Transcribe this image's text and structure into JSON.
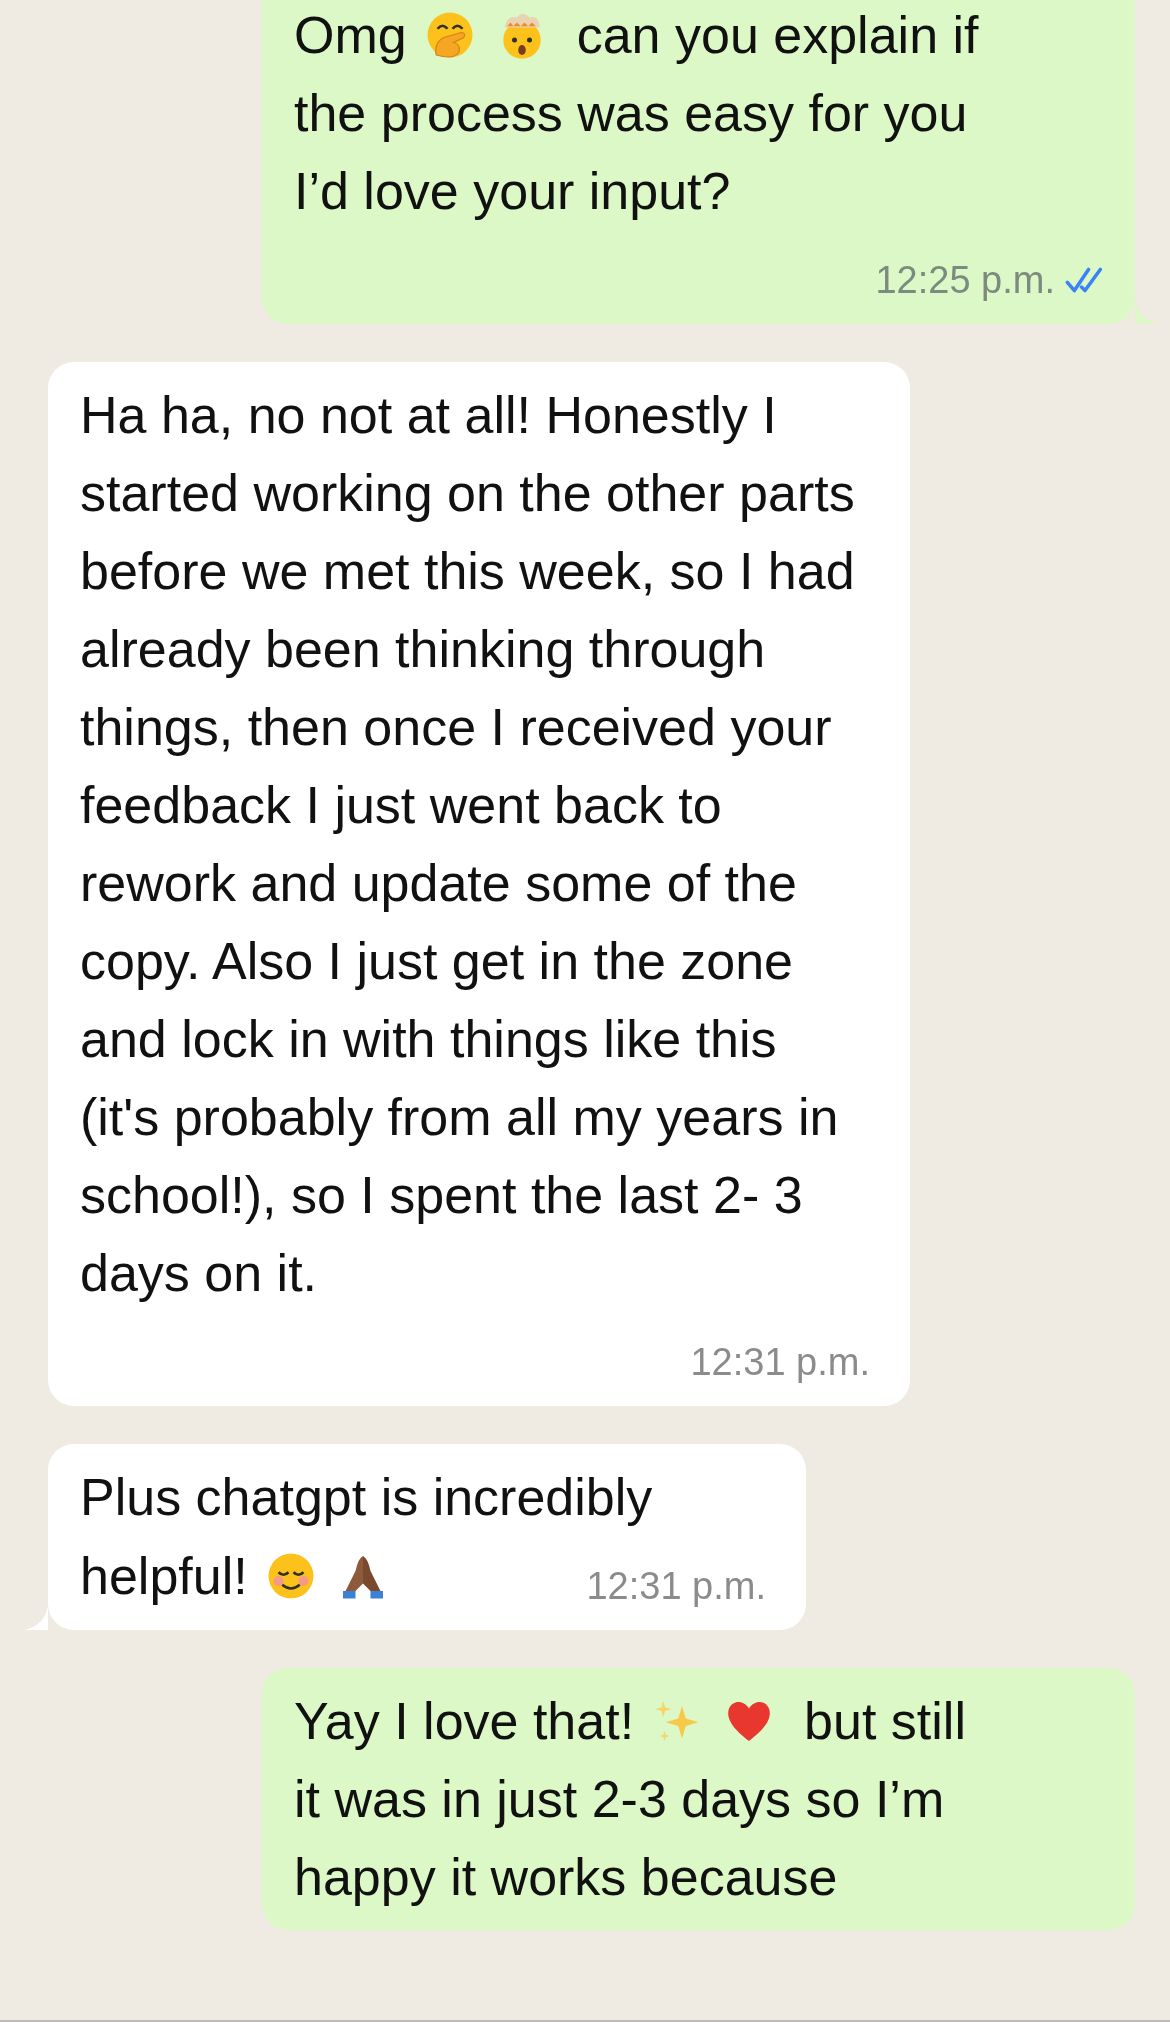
{
  "messages": [
    {
      "outgoing": true,
      "tail": true,
      "lines": [
        [
          {
            "kind": "text",
            "text": "Omg"
          },
          {
            "kind": "hand-over-mouth"
          },
          {
            "kind": "exploding-head"
          },
          {
            "kind": "text",
            "text": "can you explain if"
          }
        ],
        [
          {
            "kind": "text",
            "text": "the process was easy for you"
          }
        ],
        [
          {
            "kind": "text",
            "text": "I’d love your input?"
          }
        ],
        [
          {
            "kind": "time",
            "text": "12:25 p.m.",
            "read": true
          }
        ]
      ]
    },
    {
      "outgoing": false,
      "tail": false,
      "lines": [
        [
          {
            "kind": "text",
            "text": "Ha ha, no not at all! Honestly I started working on the other parts before we met this week, so I had already been thinking through things, then once I received your feedback I just went back to rework and update some of the copy. Also I just get in the zone and lock in with things like this (it's probably from all my years in school!), so I spent the last 2- 3 days on it."
          }
        ],
        [
          {
            "kind": "time",
            "text": "12:31 p.m."
          }
        ]
      ]
    },
    {
      "outgoing": false,
      "tail": true,
      "lines": [
        [
          {
            "kind": "text",
            "text": "Plus chatgpt is incredibly"
          }
        ],
        [
          {
            "kind": "text",
            "text": "helpful!"
          },
          {
            "kind": "smiling-face"
          },
          {
            "kind": "praying-hands"
          },
          {
            "kind": "time",
            "text": "12:31 p.m."
          }
        ]
      ]
    },
    {
      "outgoing": true,
      "tail": false,
      "lines": [
        [
          {
            "kind": "text",
            "text": "Yay I love that!"
          },
          {
            "kind": "sparkles"
          },
          {
            "kind": "heart"
          },
          {
            "kind": "text",
            "text": "but still"
          }
        ],
        [
          {
            "kind": "text",
            "text": "it was in just 2-3 days so I’m"
          }
        ],
        [
          {
            "kind": "text",
            "text": "happy it works because"
          }
        ]
      ]
    }
  ]
}
